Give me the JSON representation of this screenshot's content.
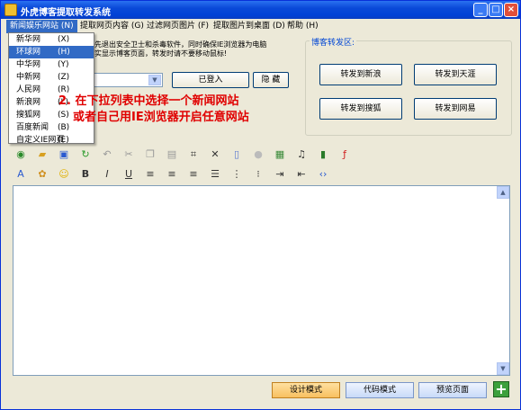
{
  "window": {
    "title": "外虎博客提取转发系统"
  },
  "menubar": [
    {
      "label": "新闻娱乐网站 (N)"
    },
    {
      "label": "提取网页内容 (G)"
    },
    {
      "label": "过滤网页图片 (F)"
    },
    {
      "label": "提取图片到桌面 (D)"
    },
    {
      "label": "帮助 (H)"
    }
  ],
  "dropdown": [
    {
      "label": "新华网",
      "key": "(X)"
    },
    {
      "label": "环球网",
      "key": "(H)"
    },
    {
      "label": "中华网",
      "key": "(Y)"
    },
    {
      "label": "中新网",
      "key": "(Z)"
    },
    {
      "label": "人民网",
      "key": "(R)"
    },
    {
      "label": "新浪网",
      "key": "(L)"
    },
    {
      "label": "搜狐网",
      "key": "(S)"
    },
    {
      "label": "百度新闻",
      "key": "(B)"
    },
    {
      "label": "自定义IE网页",
      "key": "(E)"
    }
  ],
  "notice": {
    "line1": "改先退出安全卫士和杀毒软件，同时确保IE浏览器为电脑",
    "line2": "确实显示博客页面，转发时请不要移动鼠标!"
  },
  "login": {
    "logged_in": "已登入",
    "hide": "隐 藏"
  },
  "hint": {
    "line1": "2. 在下拉列表中选择一个新闻网站",
    "line2": "或者自己用IE浏览器开启任意网站"
  },
  "forward": {
    "group_label": "博客转发区:",
    "sina": "转发到新浪",
    "tianya": "转发到天涯",
    "sohu": "转发到搜狐",
    "netease": "转发到网易"
  },
  "modes": {
    "design": "设计模式",
    "code": "代码模式",
    "preview": "预览页面"
  },
  "icons": {
    "toolbar1": [
      "globe-icon",
      "folder-icon",
      "save-icon",
      "refresh-icon",
      "undo-icon",
      "cut-icon",
      "copy-icon",
      "paste-icon",
      "select-all-icon",
      "delete-icon",
      "find-icon",
      "image-icon",
      "table-icon",
      "music-icon",
      "video-icon",
      "flash-icon"
    ],
    "toolbar2": [
      "font-icon",
      "color-icon",
      "emoticon-icon",
      "bold-icon",
      "italic-icon",
      "underline-icon",
      "align-left-icon",
      "align-center-icon",
      "align-right-icon",
      "justify-icon",
      "ordered-list-icon",
      "unordered-list-icon",
      "indent-icon",
      "outdent-icon",
      "source-icon"
    ]
  }
}
